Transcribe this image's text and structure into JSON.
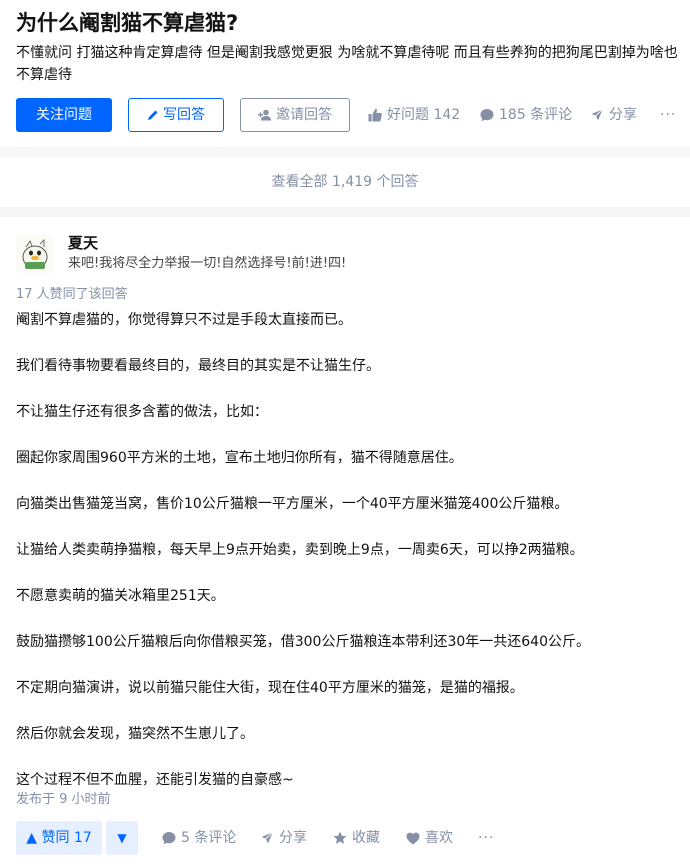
{
  "question": {
    "title": "为什么阉割猫不算虐猫?",
    "detail": "不懂就问 打猫这种肯定算虐待 但是阉割我感觉更狠 为啥就不算虐待呢 而且有些养狗的把狗尾巴割掉为啥也不算虐待",
    "follow_label": "关注问题",
    "write_label": "写回答",
    "invite_label": "邀请回答",
    "good_question_label": "好问题 142",
    "comments_label": "185 条评论",
    "share_label": "分享",
    "more_label": "···"
  },
  "view_all_label": "查看全部 1,419 个回答",
  "answer": {
    "author_name": "夏天",
    "author_bio": "来吧!我将尽全力举报一切!自然选择号!前!进!四!",
    "vote_summary": "17 人赞同了该回答",
    "paragraphs": [
      "阉割不算虐猫的，你觉得算只不过是手段太直接而已。",
      "我们看待事物要看最终目的，最终目的其实是不让猫生仔。",
      "不让猫生仔还有很多含蓄的做法，比如：",
      "圈起你家周围960平方米的土地，宣布土地归你所有，猫不得随意居住。",
      "向猫类出售猫笼当窝，售价10公斤猫粮一平方厘米，一个40平方厘米猫笼400公斤猫粮。",
      "让猫给人类卖萌挣猫粮，每天早上9点开始卖，卖到晚上9点，一周卖6天，可以挣2两猫粮。",
      "不愿意卖萌的猫关冰箱里251天。",
      "鼓励猫攒够100公斤猫粮后向你借粮买笼，借300公斤猫粮连本带利还30年一共还640公斤。",
      "不定期向猫演讲，说以前猫只能住大街，现在住40平方厘米的猫笼，是猫的福报。",
      "然后你就会发现，猫突然不生崽儿了。",
      "这个过程不但不血腥，还能引发猫的自豪感~"
    ],
    "publish_time": "发布于 9 小时前",
    "vote_up_label": "▲ 赞同 17",
    "vote_down_label": "▼",
    "comments_label": "5 条评论",
    "share_label": "分享",
    "collect_label": "收藏",
    "like_label": "喜欢",
    "more_label": "···"
  },
  "colors": {
    "accent": "#0066ff",
    "muted": "#8590a6",
    "vote_bg": "#e5efff"
  }
}
